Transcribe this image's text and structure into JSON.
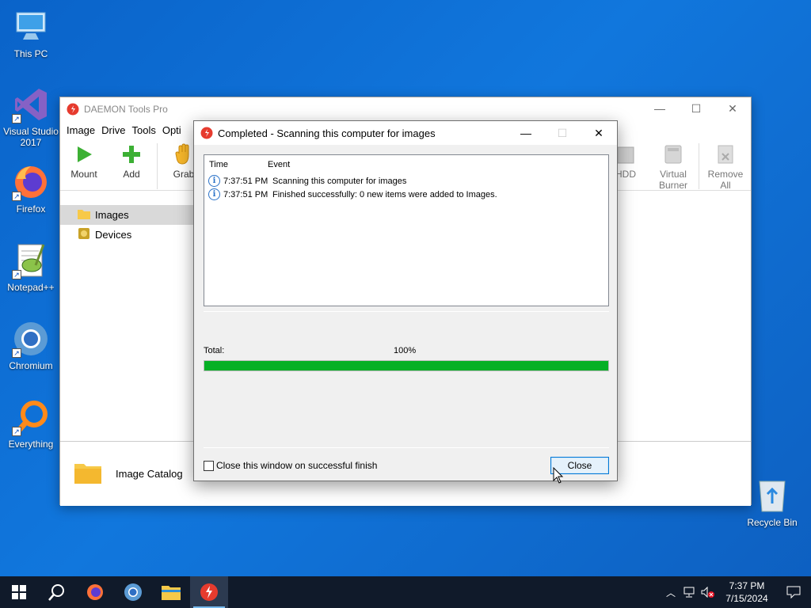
{
  "desktop": {
    "icons": [
      {
        "label": "This PC"
      },
      {
        "label": "Visual Studio\n2017"
      },
      {
        "label": "Firefox"
      },
      {
        "label": "Notepad++"
      },
      {
        "label": "Chromium"
      },
      {
        "label": "Everything"
      },
      {
        "label": "Recycle Bin"
      }
    ]
  },
  "main_window": {
    "title": "DAEMON Tools Pro",
    "menu": [
      "Image",
      "Drive",
      "Tools",
      "Opti"
    ],
    "toolbar": {
      "mount": "Mount",
      "add": "Add",
      "grab": "Grab",
      "hdd": "HDD",
      "virtual_burner": "Virtual\nBurner",
      "remove_all": "Remove\nAll"
    },
    "tree": [
      "Images",
      "Devices"
    ],
    "catalog_label": "Image Catalog"
  },
  "dialog": {
    "title": "Completed - Scanning this computer for images",
    "columns": {
      "time": "Time",
      "event": "Event"
    },
    "log": [
      {
        "time": "7:37:51 PM",
        "event": "Scanning this computer for images"
      },
      {
        "time": "7:37:51 PM",
        "event": "Finished successfully: 0 new items were added to Images."
      }
    ],
    "total_label": "Total:",
    "percent_label": "100%",
    "progress_fraction": 1.0,
    "checkbox_label": "Close this window on successful finish",
    "checkbox_checked": false,
    "close_button": "Close"
  },
  "taskbar": {
    "time": "7:37 PM",
    "date": "7/15/2024"
  },
  "colors": {
    "progress": "#06b025",
    "desktop": "#0a63c9",
    "taskbar": "#101a2a"
  }
}
